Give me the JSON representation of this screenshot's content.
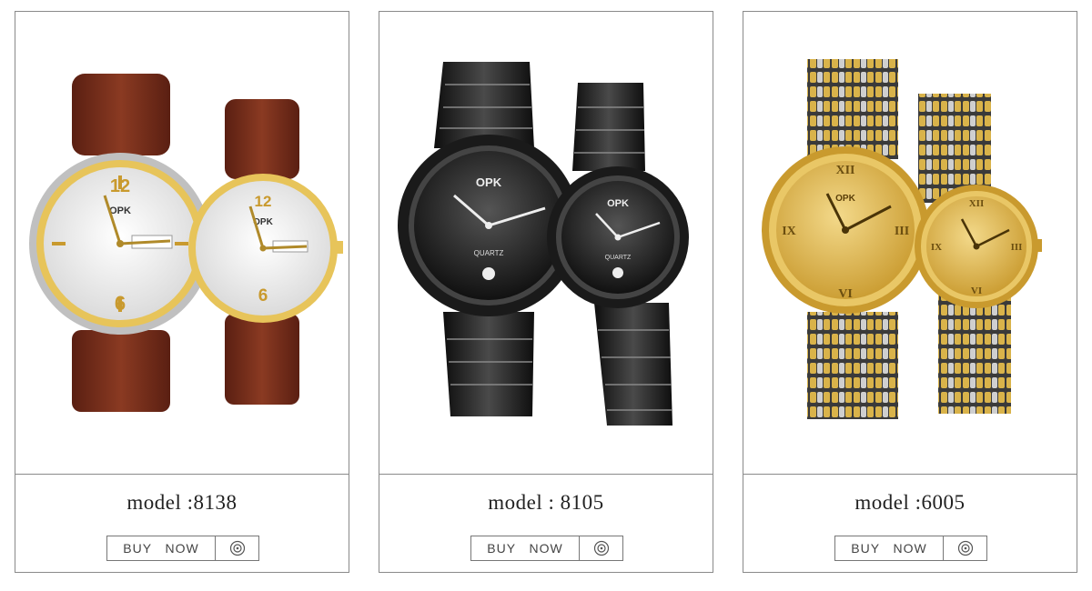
{
  "products": [
    {
      "model": "model :8138",
      "buy_label": "BUY   NOW",
      "icon": "target-icon",
      "image": "couple-watches-brown-leather-gold"
    },
    {
      "model": "model : 8105",
      "buy_label": "BUY   NOW",
      "icon": "target-icon",
      "image": "couple-watches-black-ceramic"
    },
    {
      "model": "model :6005",
      "buy_label": "BUY   NOW",
      "icon": "target-icon",
      "image": "couple-watches-gold-steel-bracelet"
    }
  ],
  "colors": {
    "border": "#8a8a8a",
    "text": "#222222",
    "gold": "#d9b34a",
    "brown": "#7a2e1c",
    "black": "#1c1c1c"
  }
}
